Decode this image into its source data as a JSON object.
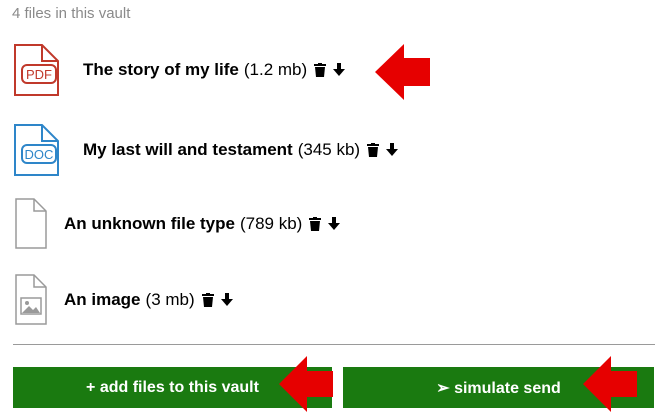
{
  "vault": {
    "count_text": "4 files in this vault"
  },
  "files": [
    {
      "name": "The story of my life",
      "size": "(1.2 mb)",
      "icon": "pdf-file-icon",
      "badge": "PDF"
    },
    {
      "name": "My last will and testament",
      "size": "(345 kb)",
      "icon": "doc-file-icon",
      "badge": "DOC"
    },
    {
      "name": "An unknown file type",
      "size": "(789 kb)",
      "icon": "generic-file-icon"
    },
    {
      "name": "An image",
      "size": "(3 mb)",
      "icon": "image-file-icon"
    }
  ],
  "actions": {
    "add_files_label": "+ add files to this vault",
    "simulate_send_label": "➢  simulate send"
  },
  "colors": {
    "pdf": "#c0392b",
    "doc": "#2e86c9",
    "generic": "#9a9a9a",
    "button": "#1a7a10",
    "arrow": "#e60000"
  }
}
